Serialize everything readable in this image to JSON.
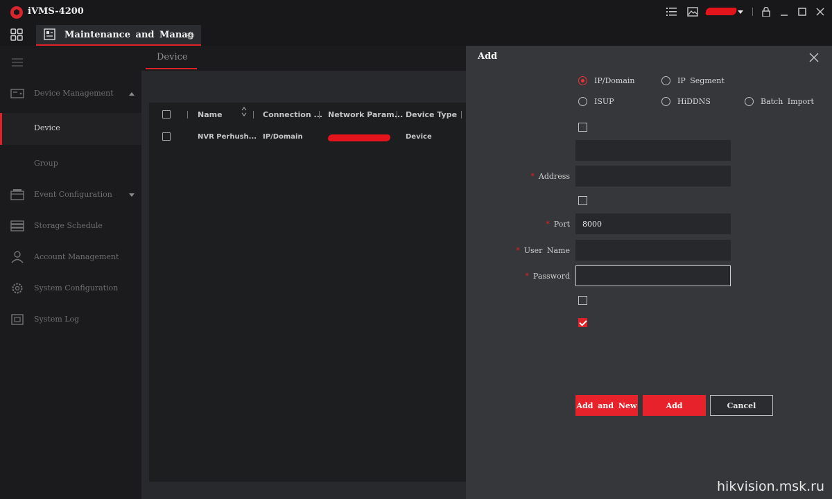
{
  "app": {
    "title": "iVMS-4200"
  },
  "titlebar": {
    "icons": [
      "list-icon",
      "image-icon",
      "lock-icon",
      "minimize-icon",
      "maximize-icon",
      "close-icon"
    ]
  },
  "tabbar": {
    "main_tab_label": "Maintenance and Management"
  },
  "sidebar": {
    "items": [
      {
        "label": "Device Management",
        "icon": "device-management-icon",
        "expanded": true,
        "children": [
          {
            "label": "Device",
            "selected": true
          },
          {
            "label": "Group",
            "selected": false
          }
        ]
      },
      {
        "label": "Event Configuration",
        "icon": "event-configuration-icon",
        "expanded": false
      },
      {
        "label": "Storage Schedule",
        "icon": "storage-schedule-icon"
      },
      {
        "label": "Account Management",
        "icon": "account-icon"
      },
      {
        "label": "System Configuration",
        "icon": "gear-icon"
      },
      {
        "label": "System Log",
        "icon": "system-log-icon"
      }
    ]
  },
  "content": {
    "tab_label": "Device",
    "table": {
      "columns": [
        "Name",
        "Connection ...",
        "Network Param...",
        "Device Type"
      ],
      "rows": [
        {
          "name": "NVR Perhush...",
          "connection": "IP/Domain",
          "network_params": "",
          "device_type": "Device"
        }
      ]
    }
  },
  "dialog": {
    "title": "Add",
    "add_modes": [
      {
        "label": "IP/Domain",
        "selected": true
      },
      {
        "label": "IP Segment",
        "selected": false
      },
      {
        "label": "ISUP",
        "selected": false
      },
      {
        "label": "HiDDNS",
        "selected": false
      },
      {
        "label": "Batch Import",
        "selected": false
      }
    ],
    "fields": {
      "name_value": "",
      "address_label": "Address",
      "address_value": "",
      "port_label": "Port",
      "port_value": "8000",
      "username_label": "User Name",
      "username_value": "",
      "password_label": "Password",
      "password_value": ""
    },
    "checkboxes": [
      false,
      false,
      false,
      true
    ],
    "buttons": {
      "add_and_new": "Add and New",
      "add": "Add",
      "cancel": "Cancel"
    }
  },
  "watermark": "hikvision.msk.ru",
  "colors": {
    "accent": "#e02128",
    "background": "#141416",
    "dialog": "#36373a"
  }
}
